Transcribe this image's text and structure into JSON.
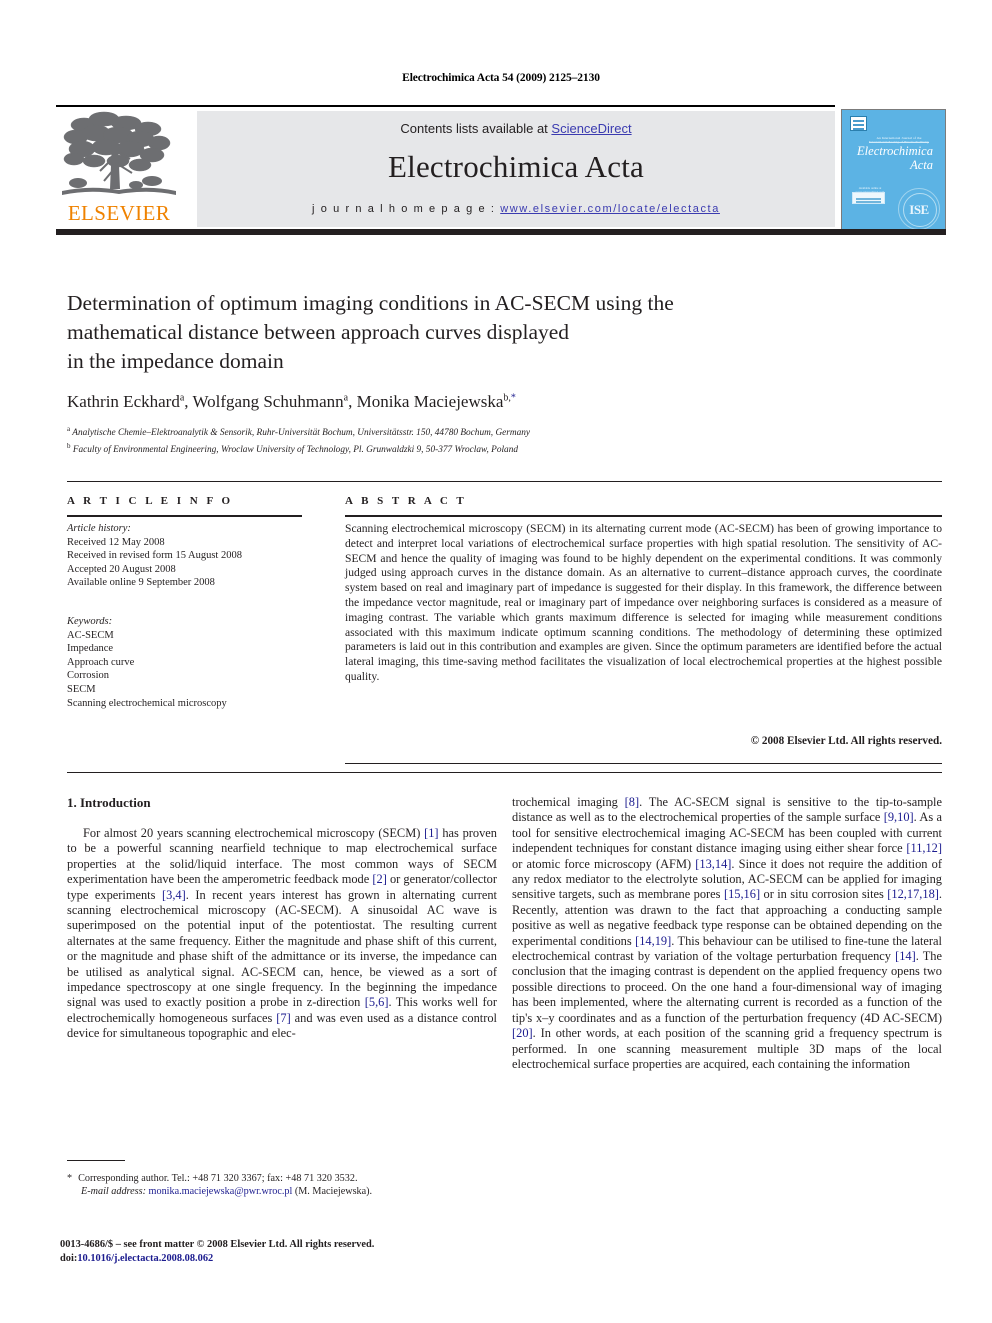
{
  "running_head": "Electrochimica Acta 54 (2009) 2125–2130",
  "masthead": {
    "contents_prefix": "Contents lists available at ",
    "sciencedirect": "ScienceDirect",
    "journal_title": "Electrochimica Acta",
    "homepage_label": "j o u r n a l   h o m e p a g e :  ",
    "homepage_url": "www.elsevier.com/locate/electacta",
    "publisher": "ELSEVIER",
    "cover": {
      "society_line": "An International Journal of the International Society of Electrochemistry",
      "title_line1": "Electrochimica",
      "title_line2": "Acta",
      "sciencedirect_caption": "Available online at www.sciencedirect.com",
      "ise_monogram": "ISE"
    }
  },
  "colors": {
    "elsevier_orange": "#ef8200",
    "link_blue": "#3b3bb0",
    "reference_blue": "#1c1c8f",
    "banner_grey": "#e6e7e9",
    "cover_blue": "#5cb3e4",
    "rule_black": "#231f20"
  },
  "article": {
    "title_line1": "Determination of optimum imaging conditions in AC-SECM using the",
    "title_line2": "mathematical distance between approach curves displayed",
    "title_line3": "in the impedance domain",
    "authors": [
      {
        "name": "Kathrin Eckhard",
        "marks": "a"
      },
      {
        "name": "Wolfgang Schuhmann",
        "marks": "a"
      },
      {
        "name": "Monika Maciejewska",
        "marks": "b,"
      }
    ],
    "author_star": "*",
    "affiliations": [
      {
        "mark": "a",
        "text": "Analytische Chemie–Elektroanalytik & Sensorik, Ruhr-Universität Bochum, Universitätsstr. 150, 44780 Bochum, Germany"
      },
      {
        "mark": "b",
        "text": "Faculty of Environmental Engineering, Wroclaw University of Technology, Pl. Grunwaldzki 9, 50-377 Wroclaw, Poland"
      }
    ]
  },
  "article_info": {
    "heading": "A R T I C L E   I N F O",
    "history_label": "Article history:",
    "history": [
      "Received 12 May 2008",
      "Received in revised form 15 August 2008",
      "Accepted 20 August 2008",
      "Available online 9 September 2008"
    ],
    "keywords_label": "Keywords:",
    "keywords": [
      "AC-SECM",
      "Impedance",
      "Approach curve",
      "Corrosion",
      "SECM",
      "Scanning electrochemical microscopy"
    ]
  },
  "abstract": {
    "heading": "A B S T R A C T",
    "text": "Scanning electrochemical microscopy (SECM) in its alternating current mode (AC-SECM) has been of growing importance to detect and interpret local variations of electrochemical surface properties with high spatial resolution. The sensitivity of AC-SECM and hence the quality of imaging was found to be highly dependent on the experimental conditions. It was commonly judged using approach curves in the distance domain. As an alternative to current–distance approach curves, the coordinate system based on real and imaginary part of impedance is suggested for their display. In this framework, the difference between the impedance vector magnitude, real or imaginary part of impedance over neighboring surfaces is considered as a measure of imaging contrast. The variable which grants maximum difference is selected for imaging while measurement conditions associated with this maximum indicate optimum scanning conditions. The methodology of determining these optimized parameters is laid out in this contribution and examples are given. Since the optimum parameters are identified before the actual lateral imaging, this time-saving method facilitates the visualization of local electrochemical properties at the highest possible quality.",
    "copyright": "© 2008 Elsevier Ltd. All rights reserved."
  },
  "body": {
    "section_number_title": "1.  Introduction",
    "left_column": {
      "paragraph_part1": "For almost 20 years scanning electrochemical microscopy (SECM) ",
      "ref1": "[1]",
      "paragraph_part2": " has proven to be a powerful scanning nearfield technique to map electrochemical surface properties at the solid/liquid interface. The most common ways of SECM experimentation have been the amperometric feedback mode ",
      "ref2": "[2]",
      "paragraph_part3": " or generator/collector type experiments ",
      "ref3": "[3,4]",
      "paragraph_part4": ". In recent years interest has grown in alternating current scanning electrochemical microscopy (AC-SECM). A sinusoidal AC wave is superimposed on the potential input of the potentiostat. The resulting current alternates at the same frequency. Either the magnitude and phase shift of this current, or the magnitude and phase shift of the admittance or its inverse, the impedance can be utilised as analytical signal. AC-SECM can, hence, be viewed as a sort of impedance spectroscopy at one single frequency. In the beginning the impedance signal was used to exactly position a probe in z-direction ",
      "ref4": "[5,6]",
      "paragraph_part5": ". This works well for electrochemically homogeneous surfaces ",
      "ref5": "[7]",
      "paragraph_part6": " and was even used as a distance control device for simultaneous topographic and elec-"
    },
    "right_column": {
      "p1": "trochemical imaging ",
      "ref8": "[8]",
      "p2": ". The AC-SECM signal is sensitive to the tip-to-sample distance as well as to the electrochemical properties of the sample surface ",
      "ref910": "[9,10]",
      "p3": ". As a tool for sensitive electrochemical imaging AC-SECM has been coupled with current independent techniques for constant distance imaging using either shear force ",
      "ref1112": "[11,12]",
      "p4": " or atomic force microscopy (AFM) ",
      "ref1314": "[13,14]",
      "p5": ". Since it does not require the addition of any redox mediator to the electrolyte solution, AC-SECM can be applied for imaging sensitive targets, such as membrane pores ",
      "ref1516": "[15,16]",
      "p6": " or in situ corrosion sites ",
      "ref121718": "[12,17,18]",
      "p7": ". Recently, attention was drawn to the fact that approaching a conducting sample positive as well as negative feedback type response can be obtained depending on the experimental conditions ",
      "ref1419": "[14,19]",
      "p8": ". This behaviour can be utilised to fine-tune the lateral electrochemical contrast by variation of the voltage perturbation frequency ",
      "ref14": "[14]",
      "p9": ". The conclusion that the imaging contrast is dependent on the applied frequency opens two possible directions to proceed. On the one hand a four-dimensional way of imaging has been implemented, where the alternating current is recorded as a function of the tip's x–y coordinates and as a function of the perturbation frequency (4D AC-SECM) ",
      "ref20": "[20]",
      "p10": ". In other words, at each position of the scanning grid a frequency spectrum is performed. In one scanning measurement multiple 3D maps of the local electrochemical surface properties are acquired, each containing the information"
    }
  },
  "footnote": {
    "star": "*",
    "corresponding": "Corresponding author. Tel.: +48 71 320 3367; fax: +48 71 320 3532.",
    "email_label": "E-mail address:",
    "email": "monika.maciejewska@pwr.wroc.pl",
    "email_suffix": "(M. Maciejewska)."
  },
  "imprint": {
    "front_matter": "0013-4686/$ – see front matter © 2008 Elsevier Ltd. All rights reserved.",
    "doi_label": "doi:",
    "doi": "10.1016/j.electacta.2008.08.062"
  }
}
